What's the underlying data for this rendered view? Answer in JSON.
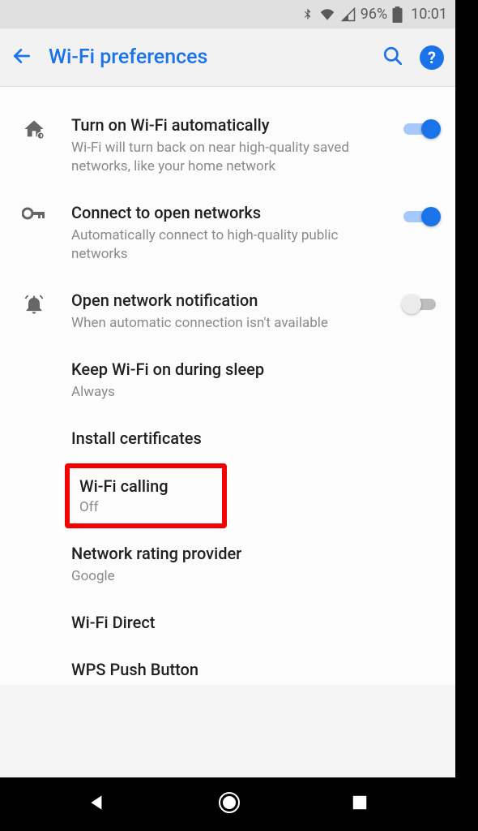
{
  "status": {
    "battery_pct": "96%",
    "time": "10:01"
  },
  "appbar": {
    "title": "Wi-Fi preferences"
  },
  "items": {
    "auto_on": {
      "title": "Turn on Wi-Fi automatically",
      "sub": "Wi-Fi will turn back on near high-quality saved networks, like your home network"
    },
    "open_net": {
      "title": "Connect to open networks",
      "sub": "Automatically connect to high-quality public networks"
    },
    "open_notif": {
      "title": "Open network notification",
      "sub": "When automatic connection isn't available"
    },
    "sleep": {
      "title": "Keep Wi-Fi on during sleep",
      "sub": "Always"
    },
    "certs": {
      "title": "Install certificates"
    },
    "wifi_calling": {
      "title": "Wi-Fi calling",
      "sub": "Off"
    },
    "rating": {
      "title": "Network rating provider",
      "sub": "Google"
    },
    "direct": {
      "title": "Wi-Fi Direct"
    },
    "wps": {
      "title": "WPS Push Button"
    }
  }
}
